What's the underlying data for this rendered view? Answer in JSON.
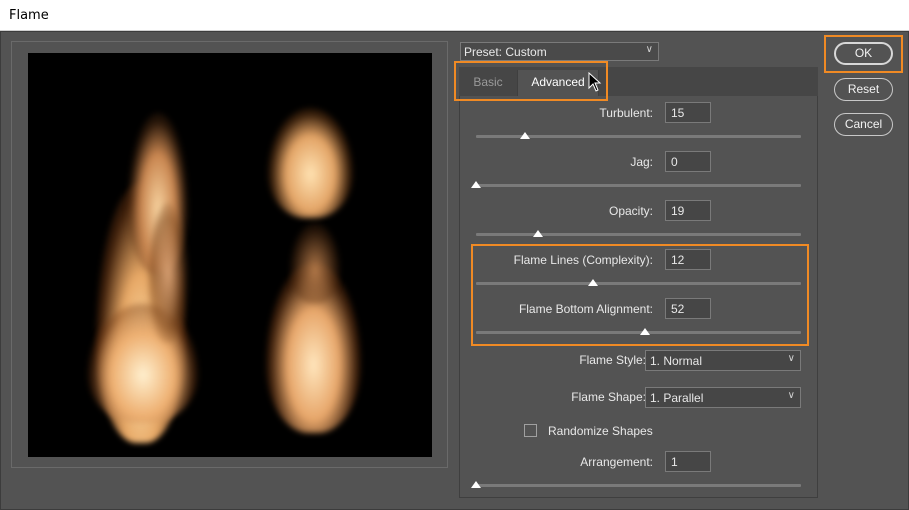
{
  "window": {
    "title": "Flame"
  },
  "preset": {
    "label": "Preset: Custom"
  },
  "tabs": [
    {
      "label": "Basic",
      "active": false
    },
    {
      "label": "Advanced",
      "active": true
    }
  ],
  "advanced": {
    "turbulent": {
      "label": "Turbulent:",
      "value": "15",
      "fraction": 0.15
    },
    "jag": {
      "label": "Jag:",
      "value": "0",
      "fraction": 0.0
    },
    "opacity": {
      "label": "Opacity:",
      "value": "19",
      "fraction": 0.19
    },
    "flame_lines": {
      "label": "Flame Lines (Complexity):",
      "value": "12",
      "fraction": 0.36
    },
    "flame_bottom_alignment": {
      "label": "Flame Bottom Alignment:",
      "value": "52",
      "fraction": 0.52
    },
    "flame_style": {
      "label": "Flame Style:",
      "value": "1. Normal"
    },
    "flame_shape": {
      "label": "Flame Shape:",
      "value": "1. Parallel"
    },
    "randomize": {
      "label": "Randomize Shapes",
      "checked": false
    },
    "arrangement": {
      "label": "Arrangement:",
      "value": "1",
      "fraction": 0.0
    }
  },
  "buttons": {
    "ok": "OK",
    "reset": "Reset",
    "cancel": "Cancel"
  },
  "colors": {
    "highlight": "#f08a24",
    "flame": "#f6c98c",
    "background": "#535353"
  },
  "icons": {
    "dropdown": "chevron-down-icon",
    "cursor": "mouse-pointer-icon"
  }
}
